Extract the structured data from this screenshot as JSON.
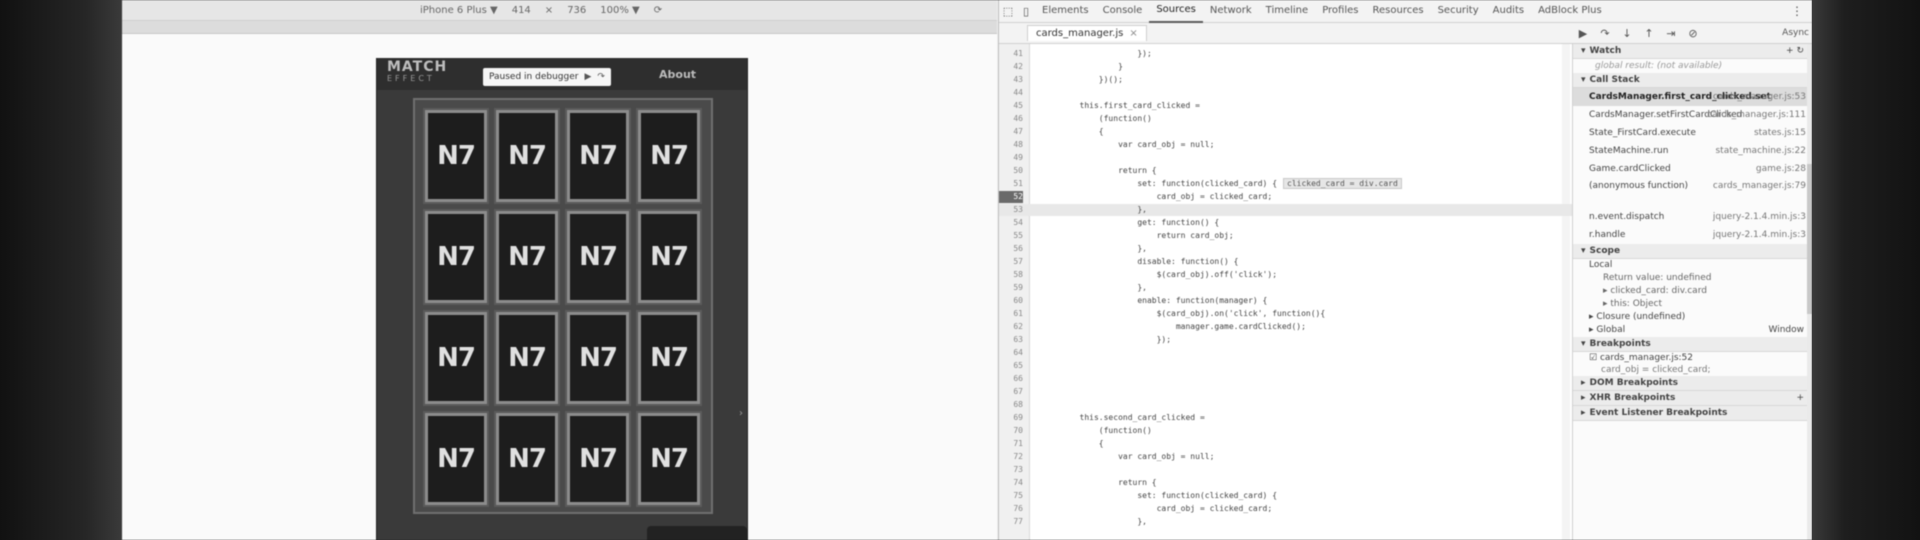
{
  "device_toolbar": {
    "device": "iPhone 6 Plus ▼",
    "width": "414",
    "times": "×",
    "height": "736",
    "zoom": "100% ▼",
    "rotate_icon": "rotate-icon"
  },
  "game": {
    "logo": "MATCH",
    "logo_sub": "EFFECT",
    "tooltip_text": "Paused in debugger",
    "tooltip_resume": "▶",
    "tooltip_step": "↷",
    "about": "About",
    "card_label": "N7",
    "card_count": 16,
    "phone_arrow": "›"
  },
  "devtools": {
    "tabs": [
      "Elements",
      "Console",
      "Sources",
      "Network",
      "Timeline",
      "Profiles",
      "Resources",
      "Security",
      "Audits",
      "AdBlock Plus"
    ],
    "active_tab": "Sources",
    "file_tab": "cards_manager.js",
    "file_tab_close": "×",
    "code_lines": [
      {
        "n": "41",
        "t": "                    });"
      },
      {
        "n": "42",
        "t": "                }"
      },
      {
        "n": "43",
        "t": "            })();"
      },
      {
        "n": "44",
        "t": ""
      },
      {
        "n": "45",
        "t": "        this.first_card_clicked ="
      },
      {
        "n": "46",
        "t": "            (function()"
      },
      {
        "n": "47",
        "t": "            {"
      },
      {
        "n": "48",
        "t": "                var card_obj = null;"
      },
      {
        "n": "49",
        "t": ""
      },
      {
        "n": "50",
        "t": "                return {"
      },
      {
        "n": "51",
        "t": "                    set: function(clicked_card) {",
        "inline": "clicked_card = div.card"
      },
      {
        "n": "52",
        "t": "                        card_obj = clicked_card;"
      },
      {
        "n": "53",
        "t": "                    },",
        "exec": true
      },
      {
        "n": "54",
        "t": "                    get: function() {"
      },
      {
        "n": "55",
        "t": "                        return card_obj;"
      },
      {
        "n": "56",
        "t": "                    },"
      },
      {
        "n": "57",
        "t": "                    disable: function() {"
      },
      {
        "n": "58",
        "t": "                        $(card_obj).off('click');"
      },
      {
        "n": "59",
        "t": "                    },"
      },
      {
        "n": "60",
        "t": "                    enable: function(manager) {"
      },
      {
        "n": "61",
        "t": "                        $(card_obj).on('click', function(){"
      },
      {
        "n": "62",
        "t": "                            manager.game.cardClicked();"
      },
      {
        "n": "63",
        "t": "                        });"
      },
      {
        "n": "64",
        "t": ""
      },
      {
        "n": "65",
        "t": ""
      },
      {
        "n": "66",
        "t": ""
      },
      {
        "n": "67",
        "t": ""
      },
      {
        "n": "68",
        "t": ""
      },
      {
        "n": "69",
        "t": "        this.second_card_clicked ="
      },
      {
        "n": "70",
        "t": "            (function()"
      },
      {
        "n": "71",
        "t": "            {"
      },
      {
        "n": "72",
        "t": "                var card_obj = null;"
      },
      {
        "n": "73",
        "t": ""
      },
      {
        "n": "74",
        "t": "                return {"
      },
      {
        "n": "75",
        "t": "                    set: function(clicked_card) {"
      },
      {
        "n": "76",
        "t": "                        card_obj = clicked_card;"
      },
      {
        "n": "77",
        "t": "                    },"
      }
    ],
    "sidebar": {
      "toolbar_icons": [
        "▶",
        "↷",
        "↓",
        "↑",
        "⇥",
        "⊘"
      ],
      "async_label": "Async",
      "watch": {
        "title": "Watch",
        "add": "+",
        "refresh": "↻",
        "empty": "global result: (not available)"
      },
      "call_stack": {
        "title": "Call Stack",
        "frames": [
          {
            "fn": "CardsManager.first_card_clicked.set",
            "loc": "cards_manager.js:53",
            "selected": true
          },
          {
            "fn": "CardsManager.setFirstCardClicked",
            "loc": "cards_manager.js:111"
          },
          {
            "fn": "State_FirstCard.execute",
            "loc": "states.js:15"
          },
          {
            "fn": "StateMachine.run",
            "loc": "state_machine.js:22"
          },
          {
            "fn": "Game.cardClicked",
            "loc": "game.js:28"
          },
          {
            "fn": "(anonymous function)",
            "loc": "cards_manager.js:79",
            "tall": true
          },
          {
            "fn": "n.event.dispatch",
            "loc": "jquery-2.1.4.min.js:3"
          },
          {
            "fn": "r.handle",
            "loc": "jquery-2.1.4.min.js:3"
          }
        ]
      },
      "scope": {
        "title": "Scope",
        "local": "Local",
        "return_value": "Return value: undefined",
        "clicked_card": "▸ clicked_card: div.card",
        "this_obj": "▸ this: Object",
        "closure": "▸ Closure (undefined)",
        "global": "▸ Global",
        "global_val": "Window"
      },
      "breakpoints": {
        "title": "Breakpoints",
        "item_file": "cards_manager.js:52",
        "item_code": "card_obj = clicked_card;"
      },
      "dom_breakpoints": "DOM Breakpoints",
      "xhr_breakpoints": "XHR Breakpoints",
      "xhr_add": "+",
      "event_listener_breakpoints": "Event Listener Breakpoints"
    }
  }
}
